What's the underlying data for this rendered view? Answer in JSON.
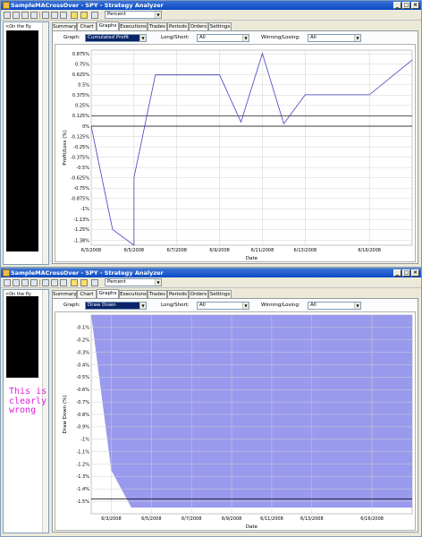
{
  "windows": [
    {
      "title": "SampleMACrossOver - SPY - Strategy Analyzer",
      "toolbar_select": "Percent",
      "tree_item": "<On the fly",
      "tabs": [
        "Summary",
        "Chart",
        "Graphs",
        "Executions",
        "Trades",
        "Periods",
        "Orders",
        "Settings"
      ],
      "active_tab": "Graphs",
      "graph_label": "Graph:",
      "graph_value": "Cumulated Profit",
      "longshort_label": "Long/Short:",
      "longshort_value": "All",
      "winlose_label": "Winning/Losing:",
      "winlose_value": "All",
      "chart_ylabel": "Profit/Loss (%)",
      "chart_xlabel": "Date"
    },
    {
      "title": "SampleMACrossOver - SPY - Strategy Analyzer",
      "toolbar_select": "Percent",
      "tree_item": "<On the fly",
      "tabs": [
        "Summary",
        "Chart",
        "Graphs",
        "Executions",
        "Trades",
        "Periods",
        "Orders",
        "Settings"
      ],
      "active_tab": "Graphs",
      "graph_label": "Graph:",
      "graph_value": "Draw Down",
      "longshort_label": "Long/Short:",
      "longshort_value": "All",
      "winlose_label": "Winning/Losing:",
      "winlose_value": "All",
      "chart_ylabel": "Draw Down (%)",
      "chart_xlabel": "Date"
    }
  ],
  "annotation": [
    "This is",
    "clearly",
    "wrong"
  ],
  "annotation_color": "#e020e0",
  "chart_data": [
    {
      "type": "line",
      "x": [
        "6/3/2008",
        "6/4/2008",
        "6/5/2008",
        "6/5/2008",
        "6/6/2008",
        "6/9/2008",
        "6/10/2008",
        "6/11/2008",
        "6/12/2008",
        "6/13/2008",
        "6/16/2008",
        "6/18/2008"
      ],
      "y": [
        0,
        -1.25,
        -1.44,
        -0.62,
        0.62,
        0.62,
        0.05,
        0.88,
        0.03,
        0.38,
        0.38,
        0.8
      ],
      "x_tick_labels": [
        "6/3/2008",
        "6/5/2008",
        "6/7/2008",
        "6/9/2008",
        "6/11/2008",
        "6/13/2008",
        "6/16/2008"
      ],
      "y_tick_labels": [
        "0.875%",
        "0.75%",
        "0.625%",
        "0.5%",
        "0.375%",
        "0.25%",
        "0.125%",
        "0%",
        "-0.125%",
        "-0.25%",
        "-0.375%",
        "-0.5%",
        "-0.625%",
        "-0.75%",
        "-0.875%",
        "-1%",
        "-1.13%",
        "-1.25%",
        "-1.38%"
      ],
      "y_ticks": [
        0.875,
        0.75,
        0.625,
        0.5,
        0.375,
        0.25,
        0.125,
        0,
        -0.125,
        -0.25,
        -0.375,
        -0.5,
        -0.625,
        -0.75,
        -0.875,
        -1,
        -1.13,
        -1.25,
        -1.38
      ],
      "ylim": [
        -1.44,
        0.92
      ],
      "xlabel": "Date",
      "ylabel": "Profit/Loss (%)",
      "hlines": [
        0.125,
        0
      ],
      "line_color": "#4040c0",
      "grid": true
    },
    {
      "type": "area",
      "x": [
        "6/2/2008",
        "6/3/2008",
        "6/4/2008",
        "6/5/2008",
        "6/18/2008"
      ],
      "y": [
        0,
        -1.25,
        -1.55,
        -1.55,
        -1.55
      ],
      "x_tick_labels": [
        "6/3/2008",
        "6/5/2008",
        "6/7/2008",
        "6/9/2008",
        "6/11/2008",
        "6/13/2008",
        "6/16/2008"
      ],
      "y_tick_labels": [
        "-0.1%",
        "-0.2%",
        "-0.3%",
        "-0.4%",
        "-0.5%",
        "-0.6%",
        "-0.7%",
        "-0.8%",
        "-0.9%",
        "-1%",
        "-1.1%",
        "-1.2%",
        "-1.3%",
        "-1.4%",
        "-1.5%"
      ],
      "y_ticks": [
        -0.1,
        -0.2,
        -0.3,
        -0.4,
        -0.5,
        -0.6,
        -0.7,
        -0.8,
        -0.9,
        -1,
        -1.1,
        -1.2,
        -1.3,
        -1.4,
        -1.5
      ],
      "ylim": [
        -1.6,
        0
      ],
      "xlabel": "Date",
      "ylabel": "Draw Down (%)",
      "hlines": [
        -1.48
      ],
      "fill_color": "#9999ee",
      "grid": true
    }
  ]
}
